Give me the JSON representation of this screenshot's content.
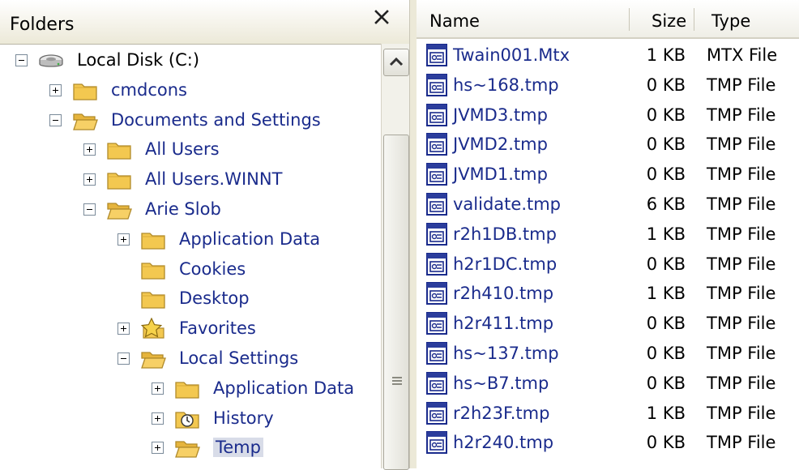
{
  "folders_panel": {
    "title": "Folders",
    "nodes": [
      {
        "label": "Local Disk (C:)",
        "expander": "minus",
        "icon": "drive-icon",
        "indent": 0
      },
      {
        "label": "cmdcons",
        "expander": "plus",
        "icon": "folder-icon",
        "indent": 1
      },
      {
        "label": "Documents and Settings",
        "expander": "minus",
        "icon": "folder-open-icon",
        "indent": 1
      },
      {
        "label": "All Users",
        "expander": "plus",
        "icon": "folder-icon",
        "indent": 2
      },
      {
        "label": "All Users.WINNT",
        "expander": "plus",
        "icon": "folder-icon",
        "indent": 2
      },
      {
        "label": "Arie Slob",
        "expander": "minus",
        "icon": "folder-open-icon",
        "indent": 2
      },
      {
        "label": "Application Data",
        "expander": "plus",
        "icon": "folder-icon",
        "indent": 3
      },
      {
        "label": "Cookies",
        "expander": "none",
        "icon": "folder-icon",
        "indent": 3
      },
      {
        "label": "Desktop",
        "expander": "none",
        "icon": "folder-icon",
        "indent": 3
      },
      {
        "label": "Favorites",
        "expander": "plus",
        "icon": "star-folder-icon",
        "indent": 3
      },
      {
        "label": "Local Settings",
        "expander": "minus",
        "icon": "folder-open-icon",
        "indent": 3
      },
      {
        "label": "Application Data",
        "expander": "plus",
        "icon": "folder-icon",
        "indent": 4
      },
      {
        "label": "History",
        "expander": "plus",
        "icon": "history-folder-icon",
        "indent": 4
      },
      {
        "label": "Temp",
        "expander": "plus",
        "icon": "folder-open-icon",
        "indent": 4,
        "selected": true
      }
    ]
  },
  "file_list": {
    "columns": {
      "name": "Name",
      "size": "Size",
      "type": "Type"
    },
    "rows": [
      {
        "name": "Twain001.Mtx",
        "size": "1 KB",
        "type": "MTX File"
      },
      {
        "name": "hs~168.tmp",
        "size": "0 KB",
        "type": "TMP File"
      },
      {
        "name": "JVMD3.tmp",
        "size": "0 KB",
        "type": "TMP File"
      },
      {
        "name": "JVMD2.tmp",
        "size": "0 KB",
        "type": "TMP File"
      },
      {
        "name": "JVMD1.tmp",
        "size": "0 KB",
        "type": "TMP File"
      },
      {
        "name": "validate.tmp",
        "size": "6 KB",
        "type": "TMP File"
      },
      {
        "name": "r2h1DB.tmp",
        "size": "1 KB",
        "type": "TMP File"
      },
      {
        "name": "h2r1DC.tmp",
        "size": "0 KB",
        "type": "TMP File"
      },
      {
        "name": "r2h410.tmp",
        "size": "1 KB",
        "type": "TMP File"
      },
      {
        "name": "h2r411.tmp",
        "size": "0 KB",
        "type": "TMP File"
      },
      {
        "name": "hs~137.tmp",
        "size": "0 KB",
        "type": "TMP File"
      },
      {
        "name": "hs~B7.tmp",
        "size": "0 KB",
        "type": "TMP File"
      },
      {
        "name": "r2h23F.tmp",
        "size": "1 KB",
        "type": "TMP File"
      },
      {
        "name": "h2r240.tmp",
        "size": "0 KB",
        "type": "TMP File"
      }
    ]
  },
  "colors": {
    "link_text": "#1a2b8c",
    "folder_yellow": "#f3c850",
    "header_bg": "#ece9d8",
    "selected_bg": "#d8dce8"
  }
}
